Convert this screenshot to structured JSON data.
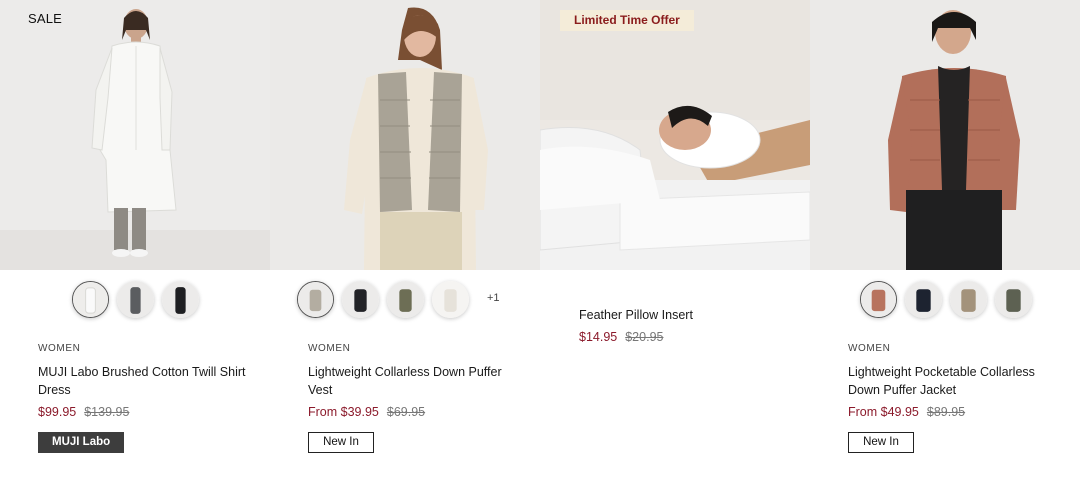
{
  "products": [
    {
      "badge": "SALE",
      "category": "WOMEN",
      "title": "MUJI Labo Brushed Cotton Twill Shirt Dress",
      "price": "$99.95",
      "old_price": "$139.95",
      "tag": "MUJI Labo",
      "swatches": [
        {
          "color": "#eceae6",
          "accent": "#c9c5bf"
        },
        {
          "color": "#5b5d60",
          "accent": "#8d8f92"
        },
        {
          "color": "#1e1f22",
          "accent": "#4a4b4f"
        }
      ]
    },
    {
      "category": "WOMEN",
      "title": "Lightweight Collarless Down Puffer Vest",
      "price": "From $39.95",
      "old_price": "$69.95",
      "tag": "New In",
      "more_colors": "+1",
      "swatches": [
        {
          "color": "#b3ada1",
          "accent": "#d8cfbd"
        },
        {
          "color": "#222327",
          "accent": "#4f5055"
        },
        {
          "color": "#6d6e55",
          "accent": "#9a9b80"
        },
        {
          "color": "#f2f0ec",
          "accent": "#ded9d0"
        }
      ]
    },
    {
      "badge": "Limited Time Offer",
      "title": "Feather Pillow Insert",
      "price": "$14.95",
      "old_price": "$20.95"
    },
    {
      "category": "WOMEN",
      "title": "Lightweight Pocketable Collarless Down Puffer Jacket",
      "price": "From $49.95",
      "old_price": "$89.95",
      "tag": "New In",
      "swatches": [
        {
          "color": "#b8735e",
          "accent": "#d19a86"
        },
        {
          "color": "#1d2330",
          "accent": "#4a5060"
        },
        {
          "color": "#a3927b",
          "accent": "#c8b9a2"
        },
        {
          "color": "#5d6152",
          "accent": "#878b7b"
        }
      ]
    }
  ]
}
